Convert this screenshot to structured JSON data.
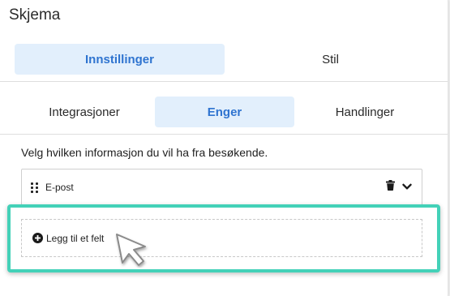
{
  "panel": {
    "title": "Skjema"
  },
  "main_tabs": [
    {
      "label": "Innstillinger",
      "active": true
    },
    {
      "label": "Stil",
      "active": false
    }
  ],
  "sub_tabs": [
    {
      "label": "Integrasjoner",
      "active": false
    },
    {
      "label": "Enger",
      "active": true
    },
    {
      "label": "Handlinger",
      "active": false
    }
  ],
  "fields_section": {
    "prompt": "Velg hvilken informasjon du vil ha fra besøkende.",
    "fields": [
      {
        "label": "E-post",
        "icons": [
          "drag-handle-icon",
          "trash-icon",
          "chevron-down-icon"
        ]
      }
    ],
    "add_field_label": "Legg til et felt"
  },
  "colors": {
    "accent": "#2f74d0",
    "active_tab_bg": "#e2effc",
    "highlight": "#43d1b8"
  }
}
